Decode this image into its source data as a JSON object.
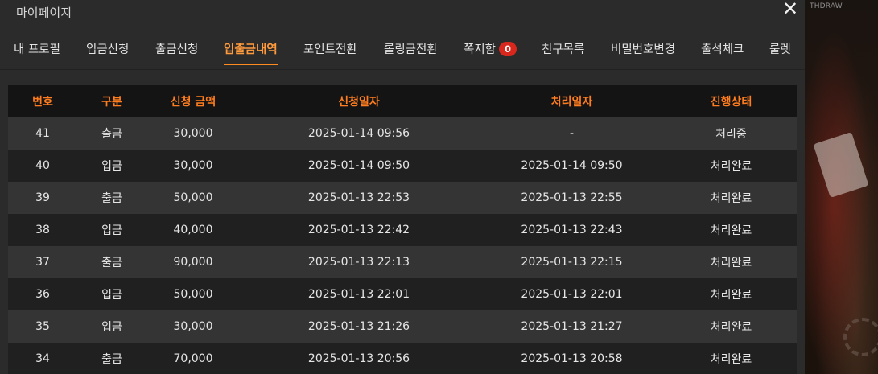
{
  "background": {
    "corner_text": "THDRAW"
  },
  "modal": {
    "title": "마이페이지",
    "close_glyph": "✕"
  },
  "tabs": [
    {
      "label": "내 프로필",
      "active": false
    },
    {
      "label": "입금신청",
      "active": false
    },
    {
      "label": "출금신청",
      "active": false
    },
    {
      "label": "입출금내역",
      "active": true
    },
    {
      "label": "포인트전환",
      "active": false
    },
    {
      "label": "롤링금전환",
      "active": false
    },
    {
      "label": "쪽지함",
      "active": false,
      "badge": "0"
    },
    {
      "label": "친구목록",
      "active": false
    },
    {
      "label": "비밀번호변경",
      "active": false
    },
    {
      "label": "출석체크",
      "active": false
    },
    {
      "label": "룰렛",
      "active": false
    }
  ],
  "colors": {
    "accent": "#ff7d1f",
    "badge": "#d8281e"
  },
  "table": {
    "columns": [
      "번호",
      "구분",
      "신청 금액",
      "신청일자",
      "처리일자",
      "진행상태"
    ],
    "rows": [
      [
        "41",
        "출금",
        "30,000",
        "2025-01-14 09:56",
        "-",
        "처리중"
      ],
      [
        "40",
        "입금",
        "30,000",
        "2025-01-14 09:50",
        "2025-01-14 09:50",
        "처리완료"
      ],
      [
        "39",
        "출금",
        "50,000",
        "2025-01-13 22:53",
        "2025-01-13 22:55",
        "처리완료"
      ],
      [
        "38",
        "입금",
        "40,000",
        "2025-01-13 22:42",
        "2025-01-13 22:43",
        "처리완료"
      ],
      [
        "37",
        "출금",
        "90,000",
        "2025-01-13 22:13",
        "2025-01-13 22:15",
        "처리완료"
      ],
      [
        "36",
        "입금",
        "50,000",
        "2025-01-13 22:01",
        "2025-01-13 22:01",
        "처리완료"
      ],
      [
        "35",
        "입금",
        "30,000",
        "2025-01-13 21:26",
        "2025-01-13 21:27",
        "처리완료"
      ],
      [
        "34",
        "출금",
        "70,000",
        "2025-01-13 20:56",
        "2025-01-13 20:58",
        "처리완료"
      ]
    ]
  }
}
